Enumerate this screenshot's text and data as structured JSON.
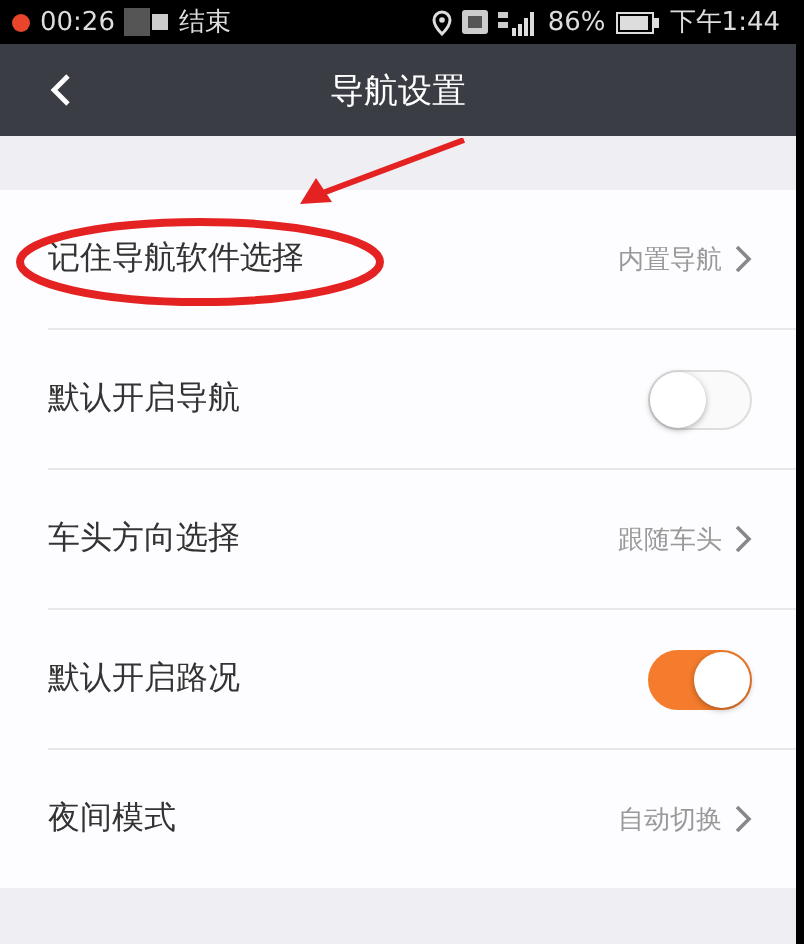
{
  "status_bar": {
    "recording_time": "00:26",
    "recording_label": "结束",
    "battery": "86%",
    "time": "下午1:44"
  },
  "header": {
    "title": "导航设置"
  },
  "rows": [
    {
      "kind": "link",
      "label": "记住导航软件选择",
      "value": "内置导航",
      "highlighted": true
    },
    {
      "kind": "toggle",
      "label": "默认开启导航",
      "on": false
    },
    {
      "kind": "link",
      "label": "车头方向选择",
      "value": "跟随车头"
    },
    {
      "kind": "toggle",
      "label": "默认开启路况",
      "on": true
    },
    {
      "kind": "link",
      "label": "夜间模式",
      "value": "自动切换"
    }
  ]
}
